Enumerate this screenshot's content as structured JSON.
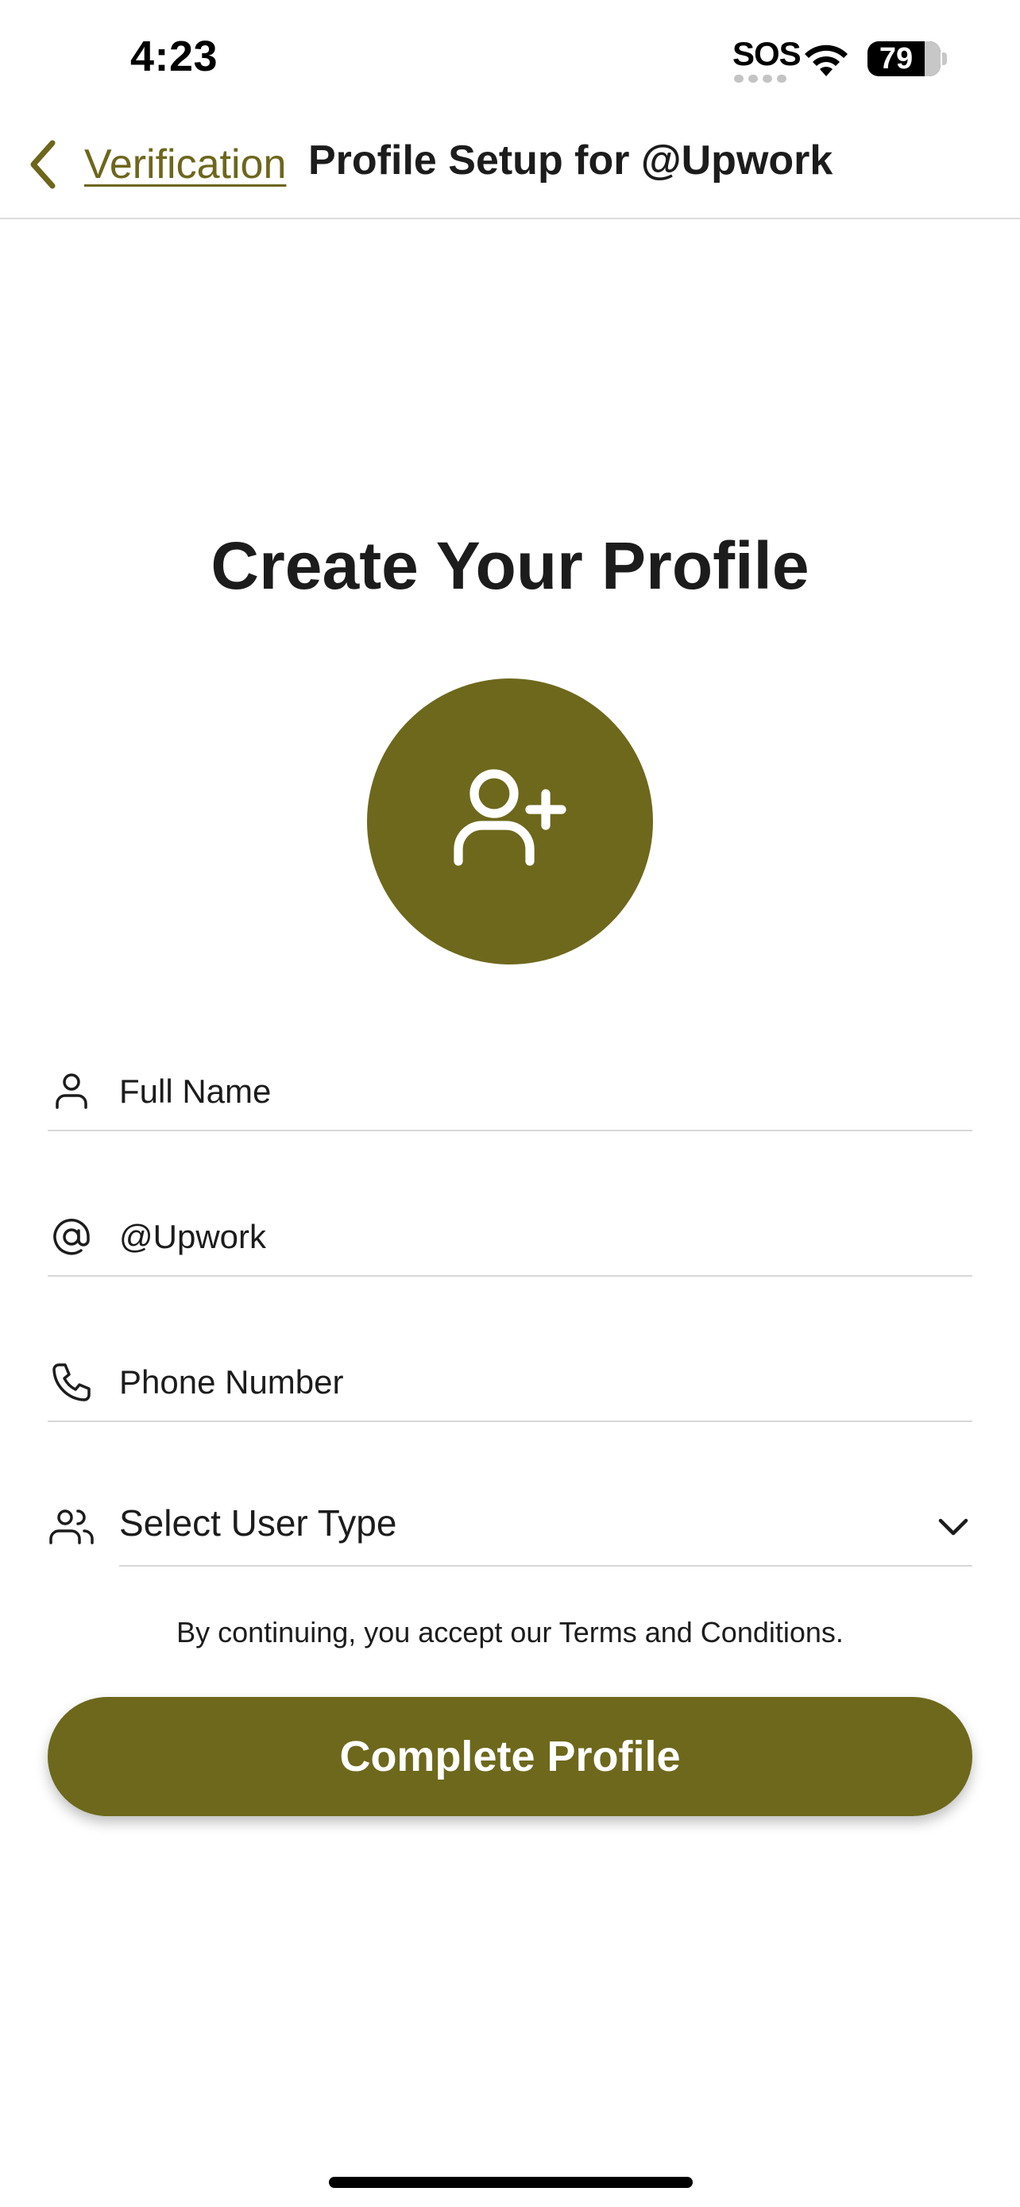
{
  "status_bar": {
    "time": "4:23",
    "sos": "SOS",
    "battery": "79"
  },
  "nav": {
    "back_label": "Verification",
    "title": "Profile Setup for @Upwork"
  },
  "main": {
    "title": "Create Your Profile",
    "fields": {
      "full_name_placeholder": "Full Name",
      "username_value": "@Upwork",
      "phone_placeholder": "Phone Number",
      "user_type_label": "Select User Type"
    },
    "terms": "By continuing, you accept our Terms and Conditions.",
    "submit_label": "Complete Profile"
  },
  "colors": {
    "accent": "#6d681c",
    "text": "#1c1c1c",
    "divider": "#d8d8d8"
  },
  "icons": {
    "back": "chevron-left-icon",
    "avatar": "user-plus-icon",
    "full_name": "user-icon",
    "username": "at-sign-icon",
    "phone": "phone-icon",
    "user_type": "users-icon",
    "dropdown": "chevron-down-icon"
  }
}
